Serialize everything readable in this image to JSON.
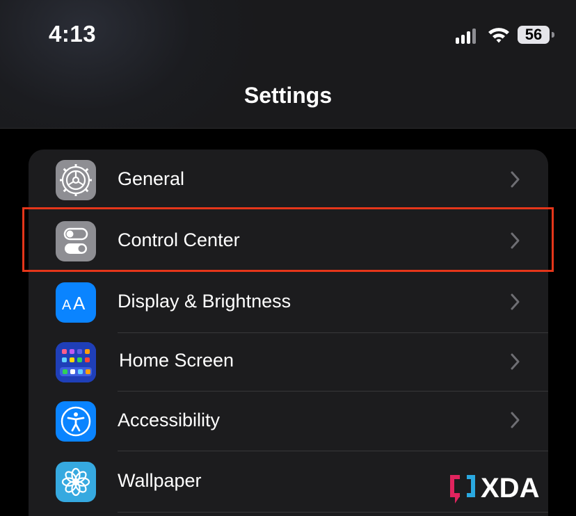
{
  "status_bar": {
    "time": "4:13",
    "battery": "56",
    "signal_bars": 4,
    "signal_active_bars": 3
  },
  "nav": {
    "title": "Settings"
  },
  "settings": {
    "items": [
      {
        "label": "General",
        "icon": "gear-icon",
        "icon_bg": "#8e8e93"
      },
      {
        "label": "Control Center",
        "icon": "toggles-icon",
        "icon_bg": "#8e8e93"
      },
      {
        "label": "Display & Brightness",
        "icon": "text-size-icon",
        "icon_bg": "#0a84ff"
      },
      {
        "label": "Home Screen",
        "icon": "app-grid-icon",
        "icon_bg": "#2c4fd9"
      },
      {
        "label": "Accessibility",
        "icon": "accessibility-icon",
        "icon_bg": "#0a84ff"
      },
      {
        "label": "Wallpaper",
        "icon": "flower-icon",
        "icon_bg": "#36a9e0"
      }
    ]
  },
  "highlight_color": "#e5361a",
  "watermark": {
    "text": "XDA"
  }
}
